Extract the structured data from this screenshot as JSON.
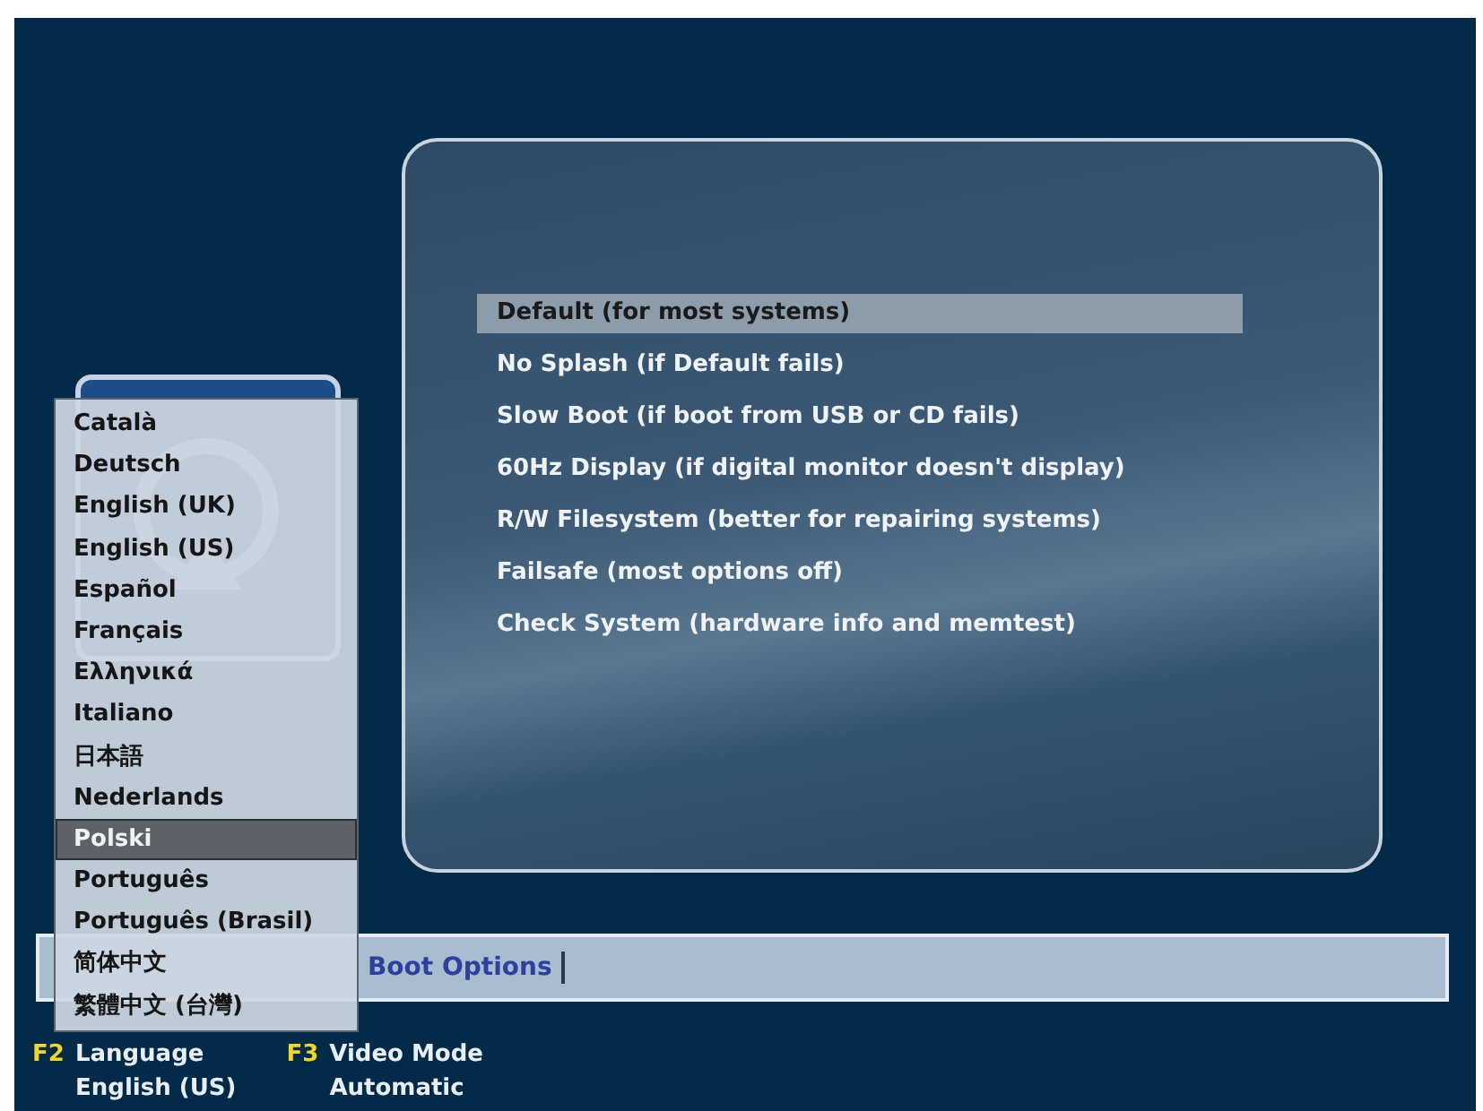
{
  "boot_menu": {
    "items": [
      {
        "label": "Default (for most systems)",
        "selected": true
      },
      {
        "label": "No Splash (if Default fails)",
        "selected": false
      },
      {
        "label": "Slow Boot (if boot from USB or CD fails)",
        "selected": false
      },
      {
        "label": "60Hz Display (if digital monitor doesn't display)",
        "selected": false
      },
      {
        "label": "R/W Filesystem (better for repairing systems)",
        "selected": false
      },
      {
        "label": "Failsafe (most options off)",
        "selected": false
      },
      {
        "label": "Check System (hardware info and memtest)",
        "selected": false
      }
    ]
  },
  "language_menu": {
    "items": [
      {
        "label": "Català",
        "selected": false
      },
      {
        "label": "Deutsch",
        "selected": false
      },
      {
        "label": "English (UK)",
        "selected": false
      },
      {
        "label": "English (US)",
        "selected": false
      },
      {
        "label": "Español",
        "selected": false
      },
      {
        "label": "Français",
        "selected": false
      },
      {
        "label": "Ελληνικά",
        "selected": false
      },
      {
        "label": "Italiano",
        "selected": false
      },
      {
        "label": "日本語",
        "selected": false
      },
      {
        "label": "Nederlands",
        "selected": false
      },
      {
        "label": "Polski",
        "selected": true
      },
      {
        "label": "Português",
        "selected": false
      },
      {
        "label": "Português (Brasil)",
        "selected": false
      },
      {
        "label": "简体中文",
        "selected": false
      },
      {
        "label": "繁體中文 (台灣)",
        "selected": false
      }
    ]
  },
  "boot_options": {
    "label": "Boot Options"
  },
  "footer": {
    "keys": [
      {
        "key": "F2",
        "label": "Language",
        "value": "English (US)"
      },
      {
        "key": "F3",
        "label": "Video Mode",
        "value": "Automatic"
      }
    ]
  }
}
